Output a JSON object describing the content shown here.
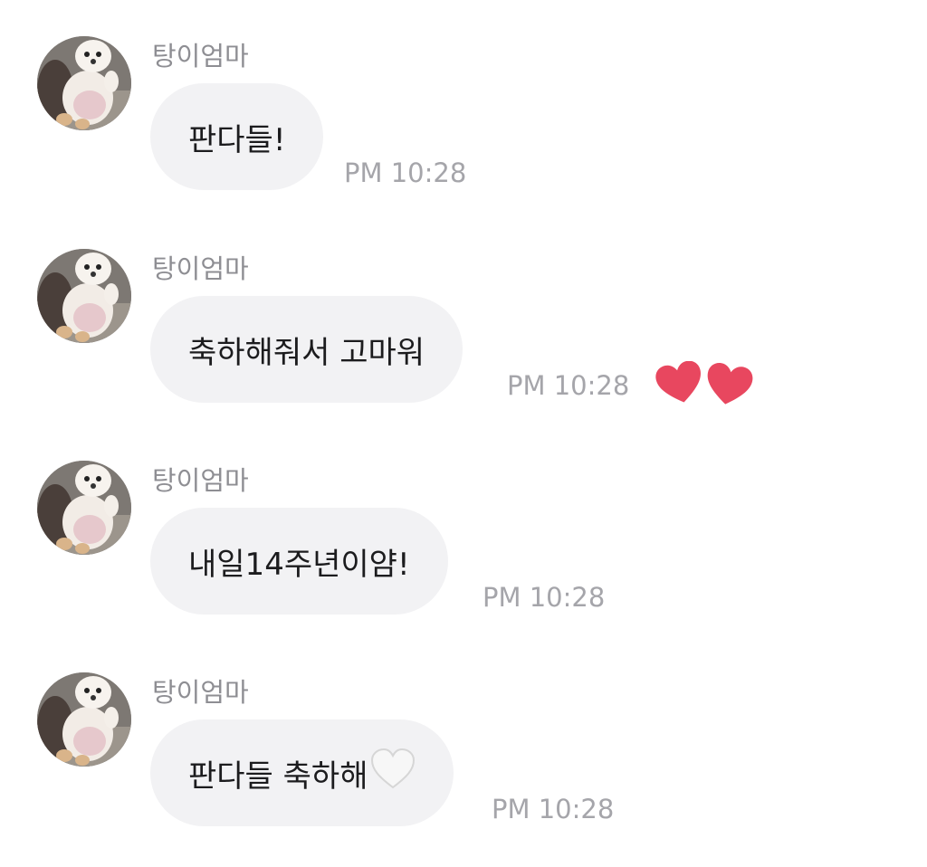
{
  "messages": [
    {
      "sender": "탕이엄마",
      "text": "판다들!",
      "time": "PM 10:28"
    },
    {
      "sender": "탕이엄마",
      "text": "축하해줘서 고마워",
      "time": "PM 10:28",
      "reaction": "two-hearts-emoji"
    },
    {
      "sender": "탕이엄마",
      "text": "내일14주년이얌!",
      "time": "PM 10:28"
    },
    {
      "sender": "탕이엄마",
      "text": "판다들 축하해",
      "time": "PM 10:28",
      "trailing_emoji": "white-heart-emoji"
    }
  ],
  "colors": {
    "bubble": "#f2f2f4",
    "sender_text": "#8e8e93",
    "timestamp_text": "#a5a5aa",
    "message_text": "#1c1c1e",
    "reaction_heart": "#e8475f"
  }
}
